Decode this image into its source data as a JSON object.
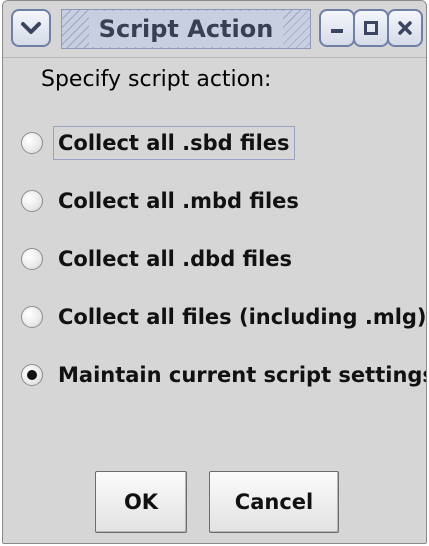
{
  "window": {
    "title": "Script Action",
    "controls": {
      "menu_icon": "chevron-down-icon",
      "minimize_icon": "minimize-icon",
      "maximize_icon": "maximize-icon",
      "close_icon": "close-icon"
    }
  },
  "prompt": "Specify script action:",
  "options": [
    {
      "label": "Collect all .sbd files",
      "checked": false,
      "focused": true
    },
    {
      "label": "Collect all .mbd files",
      "checked": false,
      "focused": false
    },
    {
      "label": "Collect all .dbd files",
      "checked": false,
      "focused": false
    },
    {
      "label": "Collect all files (including .mlg)",
      "checked": false,
      "focused": false
    },
    {
      "label": "Maintain current script settings",
      "checked": true,
      "focused": false
    }
  ],
  "buttons": {
    "ok": "OK",
    "cancel": "Cancel"
  },
  "colors": {
    "dialog_bg": "#d6d6d6",
    "title_stripe": "#9aa8c8",
    "title_text": "#3a3f55",
    "control_border": "#6f7fa6"
  }
}
